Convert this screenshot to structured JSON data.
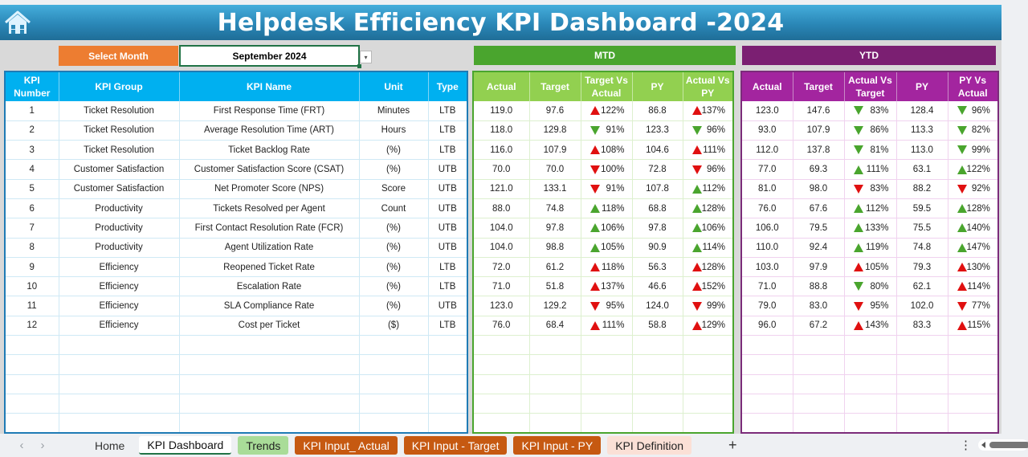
{
  "title": "Helpdesk Efficiency KPI Dashboard -2024",
  "select_month": {
    "label": "Select Month",
    "value": "September 2024"
  },
  "sections": {
    "mtd": "MTD",
    "ytd": "YTD"
  },
  "left_headers": [
    "KPI Number",
    "KPI Group",
    "KPI Name",
    "Unit",
    "Type"
  ],
  "mtd_headers": [
    "Actual",
    "Target",
    "Target Vs Actual",
    "PY",
    "Actual Vs PY"
  ],
  "ytd_headers": [
    "Actual",
    "Target",
    "Actual Vs Target",
    "PY",
    "PY Vs Actual"
  ],
  "colors": {
    "good": "#4aa52e",
    "bad": "#e01010",
    "title_blue": "#2a87b7",
    "mtd_green": "#4aa52e",
    "ytd_purple": "#7b1f72",
    "select_orange": "#ed7d31"
  },
  "rows": [
    {
      "num": "1",
      "group": "Ticket Resolution",
      "name": "First Response Time (FRT)",
      "unit": "Minutes",
      "type": "LTB",
      "mtd": {
        "actual": "119.0",
        "target": "97.6",
        "tva": "122%",
        "tva_dir": "up",
        "tva_status": "bad",
        "py": "86.8",
        "avp": "137%",
        "avp_dir": "up",
        "avp_status": "bad"
      },
      "ytd": {
        "actual": "123.0",
        "target": "147.6",
        "avt": "83%",
        "avt_dir": "down",
        "avt_status": "good",
        "py": "128.4",
        "pva": "96%",
        "pva_dir": "down",
        "pva_status": "good"
      }
    },
    {
      "num": "2",
      "group": "Ticket Resolution",
      "name": "Average Resolution Time (ART)",
      "unit": "Hours",
      "type": "LTB",
      "mtd": {
        "actual": "118.0",
        "target": "129.8",
        "tva": "91%",
        "tva_dir": "down",
        "tva_status": "good",
        "py": "123.3",
        "avp": "96%",
        "avp_dir": "down",
        "avp_status": "good"
      },
      "ytd": {
        "actual": "93.0",
        "target": "107.9",
        "avt": "86%",
        "avt_dir": "down",
        "avt_status": "good",
        "py": "113.3",
        "pva": "82%",
        "pva_dir": "down",
        "pva_status": "good"
      }
    },
    {
      "num": "3",
      "group": "Ticket Resolution",
      "name": "Ticket Backlog Rate",
      "unit": "(%)",
      "type": "LTB",
      "mtd": {
        "actual": "116.0",
        "target": "107.9",
        "tva": "108%",
        "tva_dir": "up",
        "tva_status": "bad",
        "py": "104.6",
        "avp": "111%",
        "avp_dir": "up",
        "avp_status": "bad"
      },
      "ytd": {
        "actual": "112.0",
        "target": "137.8",
        "avt": "81%",
        "avt_dir": "down",
        "avt_status": "good",
        "py": "113.0",
        "pva": "99%",
        "pva_dir": "down",
        "pva_status": "good"
      }
    },
    {
      "num": "4",
      "group": "Customer Satisfaction",
      "name": "Customer Satisfaction Score (CSAT)",
      "unit": "(%)",
      "type": "UTB",
      "mtd": {
        "actual": "70.0",
        "target": "70.0",
        "tva": "100%",
        "tva_dir": "down",
        "tva_status": "bad",
        "py": "72.8",
        "avp": "96%",
        "avp_dir": "down",
        "avp_status": "bad"
      },
      "ytd": {
        "actual": "77.0",
        "target": "69.3",
        "avt": "111%",
        "avt_dir": "up",
        "avt_status": "good",
        "py": "63.1",
        "pva": "122%",
        "pva_dir": "up",
        "pva_status": "good"
      }
    },
    {
      "num": "5",
      "group": "Customer Satisfaction",
      "name": "Net Promoter Score (NPS)",
      "unit": "Score",
      "type": "UTB",
      "mtd": {
        "actual": "121.0",
        "target": "133.1",
        "tva": "91%",
        "tva_dir": "down",
        "tva_status": "bad",
        "py": "107.8",
        "avp": "112%",
        "avp_dir": "up",
        "avp_status": "good"
      },
      "ytd": {
        "actual": "81.0",
        "target": "98.0",
        "avt": "83%",
        "avt_dir": "down",
        "avt_status": "bad",
        "py": "88.2",
        "pva": "92%",
        "pva_dir": "down",
        "pva_status": "bad"
      }
    },
    {
      "num": "6",
      "group": "Productivity",
      "name": "Tickets Resolved per Agent",
      "unit": "Count",
      "type": "UTB",
      "mtd": {
        "actual": "88.0",
        "target": "74.8",
        "tva": "118%",
        "tva_dir": "up",
        "tva_status": "good",
        "py": "68.8",
        "avp": "128%",
        "avp_dir": "up",
        "avp_status": "good"
      },
      "ytd": {
        "actual": "76.0",
        "target": "67.6",
        "avt": "112%",
        "avt_dir": "up",
        "avt_status": "good",
        "py": "59.5",
        "pva": "128%",
        "pva_dir": "up",
        "pva_status": "good"
      }
    },
    {
      "num": "7",
      "group": "Productivity",
      "name": "First Contact Resolution Rate (FCR)",
      "unit": "(%)",
      "type": "UTB",
      "mtd": {
        "actual": "104.0",
        "target": "97.8",
        "tva": "106%",
        "tva_dir": "up",
        "tva_status": "good",
        "py": "97.8",
        "avp": "106%",
        "avp_dir": "up",
        "avp_status": "good"
      },
      "ytd": {
        "actual": "106.0",
        "target": "79.5",
        "avt": "133%",
        "avt_dir": "up",
        "avt_status": "good",
        "py": "75.5",
        "pva": "140%",
        "pva_dir": "up",
        "pva_status": "good"
      }
    },
    {
      "num": "8",
      "group": "Productivity",
      "name": "Agent Utilization Rate",
      "unit": "(%)",
      "type": "UTB",
      "mtd": {
        "actual": "104.0",
        "target": "98.8",
        "tva": "105%",
        "tva_dir": "up",
        "tva_status": "good",
        "py": "90.9",
        "avp": "114%",
        "avp_dir": "up",
        "avp_status": "good"
      },
      "ytd": {
        "actual": "110.0",
        "target": "92.4",
        "avt": "119%",
        "avt_dir": "up",
        "avt_status": "good",
        "py": "74.8",
        "pva": "147%",
        "pva_dir": "up",
        "pva_status": "good"
      }
    },
    {
      "num": "9",
      "group": "Efficiency",
      "name": "Reopened Ticket Rate",
      "unit": "(%)",
      "type": "LTB",
      "mtd": {
        "actual": "72.0",
        "target": "61.2",
        "tva": "118%",
        "tva_dir": "up",
        "tva_status": "bad",
        "py": "56.3",
        "avp": "128%",
        "avp_dir": "up",
        "avp_status": "bad"
      },
      "ytd": {
        "actual": "103.0",
        "target": "97.9",
        "avt": "105%",
        "avt_dir": "up",
        "avt_status": "bad",
        "py": "79.3",
        "pva": "130%",
        "pva_dir": "up",
        "pva_status": "bad"
      }
    },
    {
      "num": "10",
      "group": "Efficiency",
      "name": "Escalation Rate",
      "unit": "(%)",
      "type": "LTB",
      "mtd": {
        "actual": "71.0",
        "target": "51.8",
        "tva": "137%",
        "tva_dir": "up",
        "tva_status": "bad",
        "py": "46.6",
        "avp": "152%",
        "avp_dir": "up",
        "avp_status": "bad"
      },
      "ytd": {
        "actual": "71.0",
        "target": "88.8",
        "avt": "80%",
        "avt_dir": "down",
        "avt_status": "good",
        "py": "62.1",
        "pva": "114%",
        "pva_dir": "up",
        "pva_status": "bad"
      }
    },
    {
      "num": "11",
      "group": "Efficiency",
      "name": "SLA Compliance Rate",
      "unit": "(%)",
      "type": "UTB",
      "mtd": {
        "actual": "123.0",
        "target": "129.2",
        "tva": "95%",
        "tva_dir": "down",
        "tva_status": "bad",
        "py": "124.0",
        "avp": "99%",
        "avp_dir": "down",
        "avp_status": "bad"
      },
      "ytd": {
        "actual": "79.0",
        "target": "83.0",
        "avt": "95%",
        "avt_dir": "down",
        "avt_status": "bad",
        "py": "102.0",
        "pva": "77%",
        "pva_dir": "down",
        "pva_status": "bad"
      }
    },
    {
      "num": "12",
      "group": "Efficiency",
      "name": "Cost per Ticket",
      "unit": "($)",
      "type": "LTB",
      "mtd": {
        "actual": "76.0",
        "target": "68.4",
        "tva": "111%",
        "tva_dir": "up",
        "tva_status": "bad",
        "py": "58.8",
        "avp": "129%",
        "avp_dir": "up",
        "avp_status": "bad"
      },
      "ytd": {
        "actual": "96.0",
        "target": "67.2",
        "avt": "143%",
        "avt_dir": "up",
        "avt_status": "bad",
        "py": "83.3",
        "pva": "115%",
        "pva_dir": "up",
        "pva_status": "bad"
      }
    }
  ],
  "empty_rows": 5,
  "sheet_tabs": [
    {
      "label": "Home",
      "style": "home"
    },
    {
      "label": "KPI Dashboard",
      "style": "active"
    },
    {
      "label": "Trends",
      "style": "trends"
    },
    {
      "label": "KPI Input_ Actual",
      "style": "orange"
    },
    {
      "label": "KPI Input - Target",
      "style": "orange"
    },
    {
      "label": "KPI Input - PY",
      "style": "orange"
    },
    {
      "label": "KPI Definition",
      "style": "def"
    }
  ],
  "icons": {
    "home": "home-icon",
    "dropdown": "chevron-down-icon",
    "prev": "chevron-left-icon",
    "next": "chevron-right-icon",
    "add": "plus-icon",
    "more": "vertical-ellipsis-icon"
  },
  "glyphs": {
    "prev": "‹",
    "next": "›",
    "add": "+",
    "more": "⋮",
    "dropdown": "▾"
  }
}
